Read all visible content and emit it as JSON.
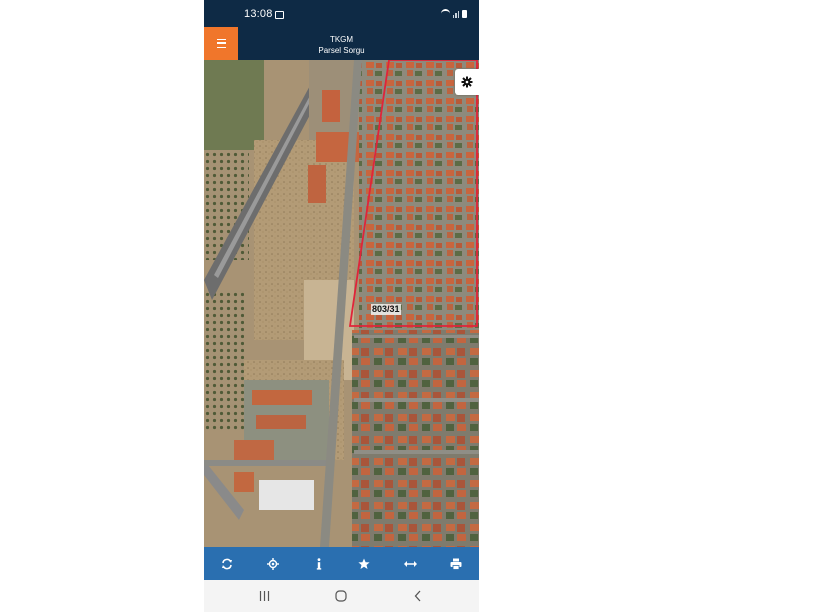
{
  "status_bar": {
    "time": "13:08"
  },
  "app_bar": {
    "title": "TKGM",
    "subtitle": "Parsel Sorgu"
  },
  "map": {
    "parcel_label": "803/31",
    "parcel_outline_color": "#e0243a"
  },
  "toolbar": {
    "icons": [
      "refresh-icon",
      "locate-icon",
      "info-icon",
      "star-icon",
      "measure-icon",
      "print-icon"
    ]
  },
  "nav_bar": {
    "icons": [
      "recent-apps-icon",
      "home-icon",
      "back-icon"
    ]
  },
  "colors": {
    "header": "#0e2a45",
    "accent": "#f0762b",
    "toolbar": "#2a6fb0"
  }
}
